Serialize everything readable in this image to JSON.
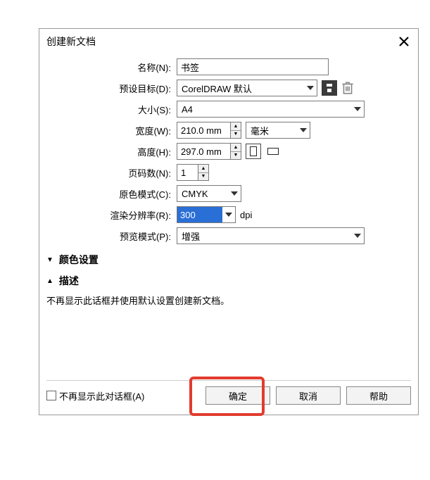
{
  "dialog": {
    "title": "创建新文档"
  },
  "fields": {
    "name_label": "名称(N):",
    "name_value": "书签",
    "preset_label": "预设目标(D):",
    "preset_value": "CorelDRAW 默认",
    "size_label": "大小(S):",
    "size_value": "A4",
    "width_label": "宽度(W):",
    "width_value": "210.0 mm",
    "unit_value": "毫米",
    "height_label": "高度(H):",
    "height_value": "297.0 mm",
    "pages_label": "页码数(N):",
    "pages_value": "1",
    "colormode_label": "原色模式(C):",
    "colormode_value": "CMYK",
    "dpi_label": "渲染分辨率(R):",
    "dpi_value": "300",
    "dpi_unit": "dpi",
    "preview_label": "预览模式(P):",
    "preview_value": "增强"
  },
  "sections": {
    "color": "颜色设置",
    "desc": "描述",
    "desc_text": "不再显示此话框并使用默认设置创建新文档。"
  },
  "footer": {
    "checkbox_label": "不再显示此对话框(A)",
    "ok": "确定",
    "cancel": "取消",
    "help": "帮助"
  }
}
